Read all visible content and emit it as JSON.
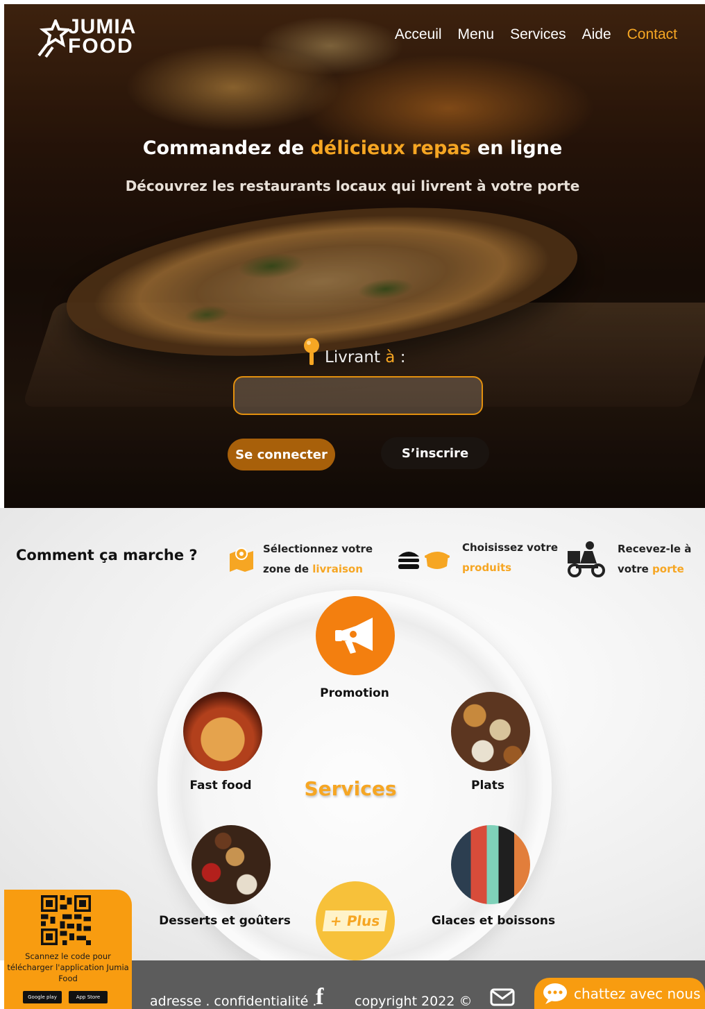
{
  "brand": {
    "logo_line1": "JUMIA",
    "logo_line2": "FOOD"
  },
  "nav": {
    "items": [
      "Acceuil",
      "Menu",
      "Services",
      "Aide",
      "Contact"
    ],
    "active": "Contact"
  },
  "hero": {
    "headline_part1": "Commandez de ",
    "headline_highlight": "délicieux repas",
    "headline_part2": " en ligne",
    "subline": "Découvrez les restaurants locaux qui livrent à votre porte",
    "deliver_label_part1": "Livrant ",
    "deliver_label_highlight": "à",
    "deliver_label_part2": " :",
    "address_value": "",
    "login_label": "Se connecter",
    "signup_label": "S’inscrire"
  },
  "how_it_works": {
    "title": "Comment ça marche ?",
    "steps": [
      {
        "line1": "Sélectionnez votre",
        "line2_plain": "zone de ",
        "line2_highlight": "livraison",
        "icon": "map-pin-icon"
      },
      {
        "line1": "Choisissez votre",
        "line2_plain": "",
        "line2_highlight": "produits",
        "icon": "burger-icon"
      },
      {
        "line1": "Recevez-le à",
        "line2_plain": "votre ",
        "line2_highlight": "porte",
        "icon": "delivery-scooter-icon"
      }
    ]
  },
  "services": {
    "center_title": "Services",
    "items": [
      {
        "label": "Promotion",
        "icon": "megaphone-icon"
      },
      {
        "label": "Fast food"
      },
      {
        "label": "Plats"
      },
      {
        "label": "Desserts et goûters"
      },
      {
        "label": "Glaces et boissons"
      }
    ],
    "plus_label": "+ Plus"
  },
  "qr_card": {
    "text": "Scannez le code pour télécharger l'application Jumia Food",
    "google_play": "Google play",
    "app_store": "App Store"
  },
  "footer": {
    "links": "adresse . confidentialité .",
    "copyright": "copyright 2022 ©",
    "chat_label": "chattez avec nous"
  },
  "colors": {
    "accent": "#f6a623",
    "promo": "#f37f0f",
    "footer": "#5c5c5c",
    "chat": "#f89c10"
  }
}
